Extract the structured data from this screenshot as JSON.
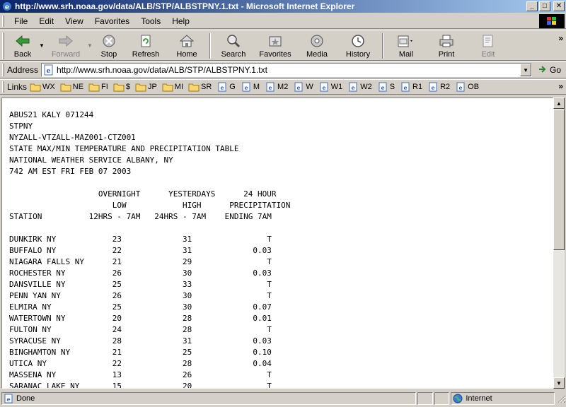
{
  "window": {
    "title": "http://www.srh.noaa.gov/data/ALB/STP/ALBSTPNY.1.txt - Microsoft Internet Explorer",
    "minimize": "_",
    "maximize": "□",
    "close": "✕"
  },
  "menu": {
    "items": [
      "File",
      "Edit",
      "View",
      "Favorites",
      "Tools",
      "Help"
    ]
  },
  "toolbar": {
    "back": "Back",
    "forward": "Forward",
    "stop": "Stop",
    "refresh": "Refresh",
    "home": "Home",
    "search": "Search",
    "favorites": "Favorites",
    "media": "Media",
    "history": "History",
    "mail": "Mail",
    "print": "Print",
    "edit": "Edit",
    "more": "»"
  },
  "address": {
    "label": "Address",
    "url": "http://www.srh.noaa.gov/data/ALB/STP/ALBSTPNY.1.txt",
    "go": "Go"
  },
  "links": {
    "label": "Links",
    "items": [
      {
        "label": "WX",
        "icon": "folder-icon"
      },
      {
        "label": "NE",
        "icon": "folder-icon"
      },
      {
        "label": "FI",
        "icon": "folder-icon"
      },
      {
        "label": "$",
        "icon": "folder-icon"
      },
      {
        "label": "JP",
        "icon": "folder-icon"
      },
      {
        "label": "MI",
        "icon": "folder-icon"
      },
      {
        "label": "SR",
        "icon": "folder-icon"
      },
      {
        "label": "G",
        "icon": "ie-page-icon"
      },
      {
        "label": "M",
        "icon": "ie-page-icon"
      },
      {
        "label": "M2",
        "icon": "ie-page-icon"
      },
      {
        "label": "W",
        "icon": "ie-page-icon"
      },
      {
        "label": "W1",
        "icon": "ie-page-icon"
      },
      {
        "label": "W2",
        "icon": "ie-page-icon"
      },
      {
        "label": "S",
        "icon": "ie-page-icon"
      },
      {
        "label": "R1",
        "icon": "ie-page-icon"
      },
      {
        "label": "R2",
        "icon": "ie-page-icon"
      },
      {
        "label": "OB",
        "icon": "ie-page-icon"
      }
    ],
    "more": "»"
  },
  "document": {
    "header_lines": [
      "ABUS21 KALY 071244",
      "STPNY",
      "NYZALL-VTZALL-MAZ001-CTZ001",
      "STATE MAX/MIN TEMPERATURE AND PRECIPITATION TABLE",
      "NATIONAL WEATHER SERVICE ALBANY, NY",
      "742 AM EST FRI FEB 07 2003"
    ],
    "column_header_lines": [
      "                   OVERNIGHT      YESTERDAYS      24 HOUR",
      "                      LOW            HIGH      PRECIPITATION",
      "STATION          12HRS - 7AM   24HRS - 7AM    ENDING 7AM"
    ],
    "rows": [
      {
        "station": "DUNKIRK NY",
        "low": "23",
        "high": "31",
        "precip": "T"
      },
      {
        "station": "BUFFALO NY",
        "low": "22",
        "high": "31",
        "precip": "0.03"
      },
      {
        "station": "NIAGARA FALLS NY",
        "low": "21",
        "high": "29",
        "precip": "T"
      },
      {
        "station": "ROCHESTER NY",
        "low": "26",
        "high": "30",
        "precip": "0.03"
      },
      {
        "station": "DANSVILLE NY",
        "low": "25",
        "high": "33",
        "precip": "T"
      },
      {
        "station": "PENN YAN NY",
        "low": "26",
        "high": "30",
        "precip": "T"
      },
      {
        "station": "ELMIRA NY",
        "low": "25",
        "high": "30",
        "precip": "0.07"
      },
      {
        "station": "WATERTOWN NY",
        "low": "20",
        "high": "28",
        "precip": "0.01"
      },
      {
        "station": "FULTON NY",
        "low": "24",
        "high": "28",
        "precip": "T"
      },
      {
        "station": "SYRACUSE NY",
        "low": "28",
        "high": "31",
        "precip": "0.03"
      },
      {
        "station": "BINGHAMTON NY",
        "low": "21",
        "high": "25",
        "precip": "0.10"
      },
      {
        "station": "UTICA NY",
        "low": "22",
        "high": "28",
        "precip": "0.04"
      },
      {
        "station": "MASSENA NY",
        "low": "13",
        "high": "26",
        "precip": "T"
      },
      {
        "station": "SARANAC LAKE NY",
        "low": "15",
        "high": "20",
        "precip": "T"
      }
    ]
  },
  "status": {
    "text": "Done",
    "zone": "Internet"
  }
}
